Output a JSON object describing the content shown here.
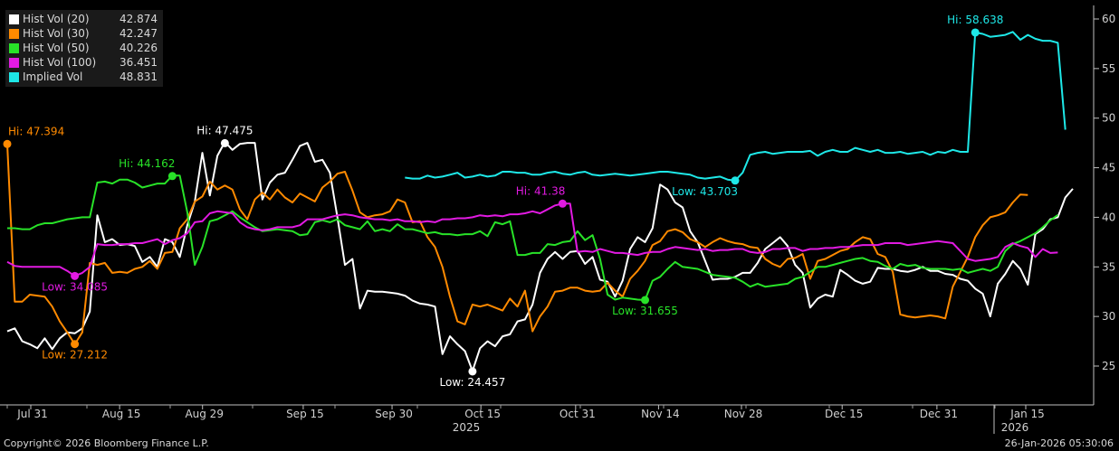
{
  "chart_data": {
    "type": "line",
    "year_labels": [
      "2025",
      "2026"
    ],
    "x_ticks": [
      "Jul 31",
      "Aug 15",
      "Aug 29",
      "Sep 15",
      "Sep 30",
      "Oct 15",
      "Oct 31",
      "Nov 14",
      "Nov 28",
      "Dec 15",
      "Dec 31",
      "Jan 15"
    ],
    "y_ticks": [
      25,
      30,
      35,
      40,
      45,
      50,
      55,
      60
    ],
    "ylim": [
      20.5,
      62
    ],
    "grid": false,
    "x_range_days": [
      -8,
      174
    ],
    "series": [
      {
        "name": "Hist Vol (20)",
        "color": "#ffffff",
        "last": "42.874",
        "start": 0,
        "values": [
          28.5,
          28.8,
          27.5,
          27.2,
          26.8,
          27.8,
          26.7,
          27.8,
          28.4,
          28.3,
          28.8,
          30.5,
          40.2,
          37.5,
          37.8,
          37.2,
          37.3,
          37.1,
          35.5,
          36.0,
          35.0,
          37.8,
          37.5,
          36.0,
          39.2,
          41.6,
          46.5,
          42.2,
          46.2,
          47.6,
          46.8,
          47.4,
          47.5,
          47.5,
          41.8,
          43.5,
          44.3,
          44.5,
          45.8,
          47.2,
          47.5,
          45.6,
          45.8,
          44.5,
          40.0,
          35.2,
          35.8,
          30.8,
          32.6,
          32.5,
          32.5,
          32.4,
          32.3,
          32.1,
          31.6,
          31.3,
          31.2,
          31.0,
          26.2,
          28.0,
          27.2,
          26.5,
          24.5,
          26.8,
          27.5,
          27.0,
          28.0,
          28.2,
          29.5,
          29.7,
          31.2,
          34.4,
          35.8,
          36.5,
          35.8,
          36.5,
          36.6,
          35.3,
          36.0,
          33.7,
          33.5,
          32.0,
          33.6,
          36.8,
          38.0,
          37.5,
          38.9,
          43.3,
          42.8,
          41.5,
          41.0,
          38.6,
          37.5,
          35.6,
          33.7,
          33.8,
          33.8,
          34.0,
          34.4,
          34.4,
          35.4,
          36.8,
          37.4,
          38.0,
          37.1,
          35.2,
          34.4,
          30.9,
          31.8,
          32.2,
          32.0,
          34.7,
          34.2,
          33.6,
          33.3,
          33.5,
          34.9,
          34.8,
          34.8,
          34.6,
          34.5,
          34.7,
          35.0,
          34.6,
          34.6,
          34.3,
          34.2,
          33.8,
          33.6,
          32.8,
          32.3,
          30.0,
          33.3,
          34.3,
          35.6,
          34.8,
          33.2,
          38.3,
          38.8,
          39.8,
          40.0,
          42.0,
          42.874
        ]
      },
      {
        "name": "Hist Vol (30)",
        "color": "#ff8a00",
        "last": "42.247",
        "start": 0,
        "values": [
          47.39,
          31.5,
          31.5,
          32.2,
          32.1,
          32.0,
          31.0,
          29.5,
          28.4,
          27.2,
          28.4,
          35.4,
          35.2,
          35.4,
          34.4,
          34.5,
          34.4,
          34.8,
          35.0,
          35.6,
          34.8,
          36.4,
          36.5,
          38.9,
          39.8,
          41.6,
          42.1,
          43.6,
          42.8,
          43.2,
          42.8,
          40.8,
          39.8,
          41.8,
          42.5,
          41.8,
          42.8,
          42.0,
          41.5,
          42.4,
          42.0,
          41.6,
          43.0,
          43.6,
          44.4,
          44.6,
          42.7,
          40.5,
          40.0,
          40.2,
          40.3,
          40.6,
          41.8,
          41.5,
          39.5,
          39.6,
          38.0,
          37.0,
          35.0,
          32.0,
          29.5,
          29.2,
          31.2,
          31.0,
          31.2,
          30.9,
          30.6,
          31.8,
          31.0,
          32.6,
          28.5,
          30.0,
          31.0,
          32.5,
          32.6,
          32.9,
          32.9,
          32.6,
          32.5,
          32.6,
          33.4,
          32.6,
          32.0,
          33.8,
          34.6,
          35.6,
          37.2,
          37.6,
          38.6,
          38.8,
          38.5,
          37.8,
          37.5,
          37.0,
          37.5,
          37.9,
          37.6,
          37.4,
          37.3,
          37.0,
          36.9,
          35.8,
          35.3,
          35.0,
          35.8,
          35.9,
          36.3,
          33.8,
          35.6,
          35.8,
          36.2,
          36.6,
          36.8,
          37.5,
          38.0,
          37.8,
          36.3,
          36.0,
          34.5,
          30.2,
          30.0,
          29.9,
          30.0,
          30.1,
          30.0,
          29.8,
          33.0,
          34.5,
          36.0,
          38.0,
          39.2,
          40.0,
          40.2,
          40.5,
          41.5,
          42.3,
          42.247
        ]
      },
      {
        "name": "Hist Vol (50)",
        "color": "#28e228",
        "last": "40.226",
        "start": 0,
        "values": [
          38.9,
          38.9,
          38.8,
          38.8,
          39.2,
          39.4,
          39.4,
          39.6,
          39.8,
          39.9,
          40.0,
          40.0,
          43.5,
          43.6,
          43.4,
          43.8,
          43.8,
          43.5,
          43.0,
          43.2,
          43.4,
          43.4,
          44.2,
          44.2,
          40.5,
          35.2,
          37.0,
          39.6,
          39.8,
          40.2,
          40.6,
          40.0,
          39.5,
          39.0,
          38.6,
          38.7,
          38.8,
          38.7,
          38.6,
          38.2,
          38.3,
          39.5,
          39.7,
          39.5,
          39.8,
          39.2,
          39.0,
          38.8,
          39.6,
          38.6,
          38.8,
          38.6,
          39.3,
          38.8,
          38.8,
          38.6,
          38.4,
          38.5,
          38.3,
          38.3,
          38.2,
          38.3,
          38.3,
          38.6,
          38.1,
          39.5,
          39.3,
          39.6,
          36.2,
          36.2,
          36.4,
          36.4,
          37.3,
          37.2,
          37.5,
          37.6,
          38.6,
          37.7,
          38.2,
          35.8,
          32.2,
          31.7,
          31.9,
          31.8,
          31.7,
          31.655,
          33.6,
          34.0,
          34.8,
          35.5,
          35.0,
          34.9,
          34.8,
          34.5,
          34.2,
          34.1,
          34.0,
          33.9,
          33.5,
          33.0,
          33.3,
          33.0,
          33.1,
          33.2,
          33.3,
          33.8,
          34.0,
          34.5,
          35.0,
          35.0,
          35.2,
          35.4,
          35.6,
          35.8,
          35.9,
          35.6,
          35.5,
          35.1,
          34.8,
          35.3,
          35.1,
          35.2,
          34.9,
          34.8,
          34.8,
          34.8,
          34.7,
          34.8,
          34.4,
          34.6,
          34.8,
          34.6,
          35.0,
          36.6,
          37.3,
          37.6,
          38.0,
          38.4,
          39.0,
          39.7,
          40.226
        ]
      },
      {
        "name": "Hist Vol (100)",
        "color": "#e21ae2",
        "last": "36.451",
        "start": 0,
        "values": [
          35.5,
          35.1,
          35.0,
          35.0,
          35.0,
          35.0,
          35.0,
          35.0,
          34.6,
          34.08,
          34.4,
          35.0,
          37.3,
          37.2,
          37.2,
          37.3,
          37.3,
          37.4,
          37.4,
          37.6,
          37.8,
          37.3,
          37.7,
          37.9,
          38.4,
          39.5,
          39.6,
          40.4,
          40.6,
          40.5,
          40.4,
          39.5,
          39.0,
          38.8,
          38.7,
          38.8,
          39.0,
          39.0,
          39.0,
          39.2,
          39.8,
          39.8,
          39.8,
          40.0,
          40.2,
          40.3,
          40.2,
          40.0,
          39.9,
          39.8,
          39.8,
          39.7,
          39.8,
          39.6,
          39.6,
          39.5,
          39.6,
          39.5,
          39.8,
          39.8,
          39.9,
          39.9,
          40.0,
          40.2,
          40.1,
          40.2,
          40.1,
          40.3,
          40.3,
          40.4,
          40.6,
          40.4,
          40.8,
          41.2,
          41.38,
          41.38,
          36.5,
          36.6,
          36.5,
          36.8,
          36.6,
          36.4,
          36.4,
          36.3,
          36.2,
          36.4,
          36.5,
          36.5,
          36.8,
          37.0,
          36.9,
          36.8,
          36.7,
          36.8,
          36.6,
          36.7,
          36.7,
          36.8,
          36.8,
          36.5,
          36.4,
          36.5,
          36.8,
          36.8,
          36.9,
          36.9,
          36.6,
          36.8,
          36.8,
          36.9,
          36.9,
          37.0,
          37.0,
          37.1,
          37.2,
          37.2,
          37.2,
          37.4,
          37.4,
          37.4,
          37.2,
          37.3,
          37.4,
          37.5,
          37.6,
          37.5,
          37.4,
          36.6,
          35.8,
          35.6,
          35.7,
          35.8,
          36.0,
          37.0,
          37.4,
          37.1,
          36.9,
          36.0,
          36.8,
          36.4,
          36.451
        ]
      },
      {
        "name": "Implied Vol",
        "color": "#1ee8e8",
        "last": "48.831",
        "start": 53,
        "values": [
          44.0,
          43.9,
          43.9,
          44.2,
          44.0,
          44.1,
          44.3,
          44.5,
          44.0,
          44.1,
          44.3,
          44.1,
          44.2,
          44.6,
          44.6,
          44.5,
          44.5,
          44.3,
          44.3,
          44.5,
          44.6,
          44.4,
          44.3,
          44.5,
          44.6,
          44.3,
          44.2,
          44.3,
          44.4,
          44.3,
          44.2,
          44.3,
          44.4,
          44.5,
          44.6,
          44.6,
          44.5,
          44.4,
          44.3,
          44.0,
          43.9,
          44.0,
          44.1,
          43.8,
          43.703,
          44.5,
          46.3,
          46.5,
          46.6,
          46.4,
          46.5,
          46.6,
          46.6,
          46.6,
          46.7,
          46.2,
          46.6,
          46.8,
          46.6,
          46.6,
          47.0,
          46.8,
          46.6,
          46.8,
          46.5,
          46.5,
          46.6,
          46.4,
          46.5,
          46.6,
          46.3,
          46.6,
          46.5,
          46.8,
          46.6,
          46.6,
          58.638,
          58.5,
          58.2,
          58.3,
          58.4,
          58.7,
          57.9,
          58.4,
          58.0,
          57.8,
          57.8,
          57.6,
          48.831
        ]
      }
    ],
    "annotations": [
      {
        "text": "Hi: 47.394",
        "series": 1,
        "index": 0,
        "value": 47.394,
        "color": "#ff8a00",
        "side": "right",
        "dy": -10
      },
      {
        "text": "Low: 27.212",
        "series": 1,
        "index": 9,
        "value": 27.212,
        "color": "#ff8a00",
        "side": "center",
        "dy": 16
      },
      {
        "text": "Low: 34.085",
        "series": 3,
        "index": 9,
        "value": 34.085,
        "color": "#e21ae2",
        "side": "center",
        "dy": 16
      },
      {
        "text": "Hi: 44.162",
        "series": 2,
        "index": 22,
        "value": 44.162,
        "color": "#28e228",
        "side": "left",
        "dy": -10
      },
      {
        "text": "Hi: 47.475",
        "series": 0,
        "index": 29,
        "value": 47.475,
        "color": "#ffffff",
        "side": "center",
        "dy": -10
      },
      {
        "text": "Low: 24.457",
        "series": 0,
        "index": 62,
        "value": 24.457,
        "color": "#ffffff",
        "side": "center",
        "dy": 16
      },
      {
        "text": "Hi: 41.38",
        "series": 3,
        "index": 74,
        "value": 41.38,
        "color": "#e21ae2",
        "side": "left",
        "dy": -10
      },
      {
        "text": "Low: 31.655",
        "series": 2,
        "index": 85,
        "value": 31.655,
        "color": "#28e228",
        "side": "center",
        "dy": 16
      },
      {
        "text": "Low: 43.703",
        "series": 4,
        "index": 44,
        "value": 43.703,
        "color": "#1ee8e8",
        "side": "left",
        "dy": 16
      },
      {
        "text": "Hi: 58.638",
        "series": 4,
        "index": 76,
        "value": 58.638,
        "color": "#1ee8e8",
        "side": "center",
        "dy": -10
      }
    ]
  },
  "footer": {
    "copyright": "Copyright© 2026 Bloomberg Finance L.P.",
    "timestamp": "26-Jan-2026 05:30:06"
  }
}
